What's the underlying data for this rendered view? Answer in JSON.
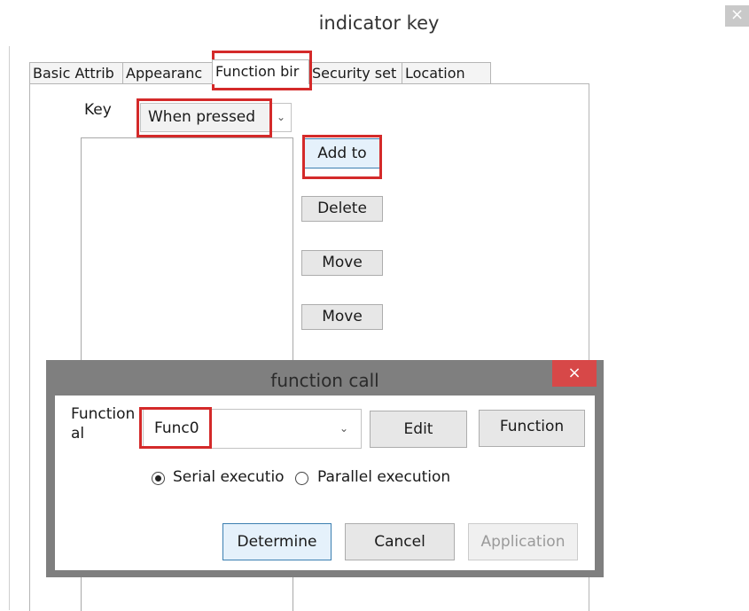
{
  "window": {
    "title": "indicator key",
    "close_glyph": "×"
  },
  "tabs": [
    {
      "label": "Basic Attrib"
    },
    {
      "label": "Appearanc"
    },
    {
      "label": "Function bir"
    },
    {
      "label": "Security set"
    },
    {
      "label": "Location"
    }
  ],
  "key_section": {
    "label": "Key",
    "selected": "When pressed",
    "arrow_glyph": "⌄"
  },
  "side_buttons": {
    "add": "Add to",
    "delete": "Delete",
    "move_up": "Move",
    "move_down": "Move"
  },
  "dialog": {
    "title": "function call",
    "close_glyph": "×",
    "function_label_line1": "Function",
    "function_label_line2": "al",
    "function_value": "Func0",
    "arrow_glyph": "⌄",
    "edit_button": "Edit",
    "function_button": "Function",
    "radio_serial": "Serial executio",
    "radio_parallel": "Parallel execution",
    "determine_button": "Determine",
    "cancel_button": "Cancel",
    "application_button": "Application"
  },
  "colors": {
    "highlight": "#d42a2a",
    "dialog_close": "#d74848",
    "dialog_frame": "#7f7f7f"
  }
}
